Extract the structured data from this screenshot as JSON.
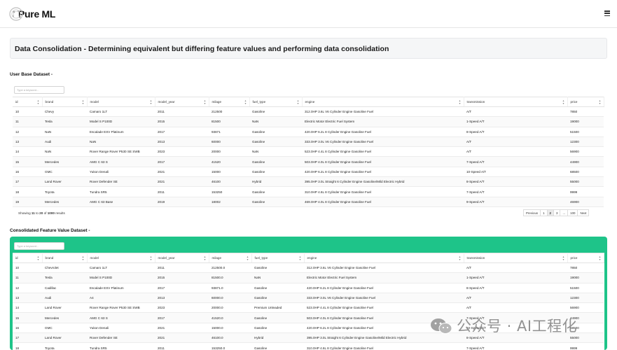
{
  "app": {
    "logo_text": "Pure ML"
  },
  "page_title": "Data Consolidation - Determining equivalent but differing feature values and performing data consolidation",
  "user_base": {
    "section_label": "User Base Dataset -",
    "search_placeholder": "Type a keyword...",
    "columns": [
      "id",
      "brand",
      "model",
      "model_year",
      "milage",
      "fuel_type",
      "engine",
      "transmission",
      "price"
    ],
    "rows": [
      [
        "10",
        "Chevy",
        "Camaro 1LT",
        "2011",
        "212500",
        "Gasoline",
        "312.0HP 3.6L V6 Cylinder Engine Gasoline Fuel",
        "A/T",
        "7850"
      ],
      [
        "11",
        "Tesla",
        "Model S P100D",
        "2015",
        "81500",
        "NaN",
        "Electric Motor Electric Fuel System",
        "1-Speed A/T",
        "19000"
      ],
      [
        "12",
        "NaN",
        "Escalade ESV Platinum",
        "2017",
        "93871",
        "Gasoline",
        "420.0HP 6.2L 8 Cylinder Engine Gasoline Fuel",
        "8-Speed A/T",
        "51500"
      ],
      [
        "13",
        "Audi",
        "NaN",
        "2013",
        "60000",
        "Gasoline",
        "333.0HP 3.0L V6 Cylinder Engine Gasoline Fuel",
        "A/T",
        "12300"
      ],
      [
        "14",
        "NaN",
        "Rover Range Rover P530 SE SWB",
        "2023",
        "20000",
        "NaN",
        "523.0HP 4.4L 8 Cylinder Engine Gasoline Fuel",
        "A/T",
        "56900"
      ],
      [
        "15",
        "Mercedes",
        "AMG C 63 S",
        "2017",
        "41520",
        "Gasoline",
        "503.0HP 4.0L 8 Cylinder Engine Gasoline Fuel",
        "7-Speed A/T",
        "44900"
      ],
      [
        "16",
        "GMC",
        "Yukon Denali",
        "2021",
        "15000",
        "Gasoline",
        "420.0HP 6.2L 8 Cylinder Engine Gasoline Fuel",
        "10-Speed A/T",
        "68500"
      ],
      [
        "17",
        "Land Rover",
        "Rover Defender SE",
        "2021",
        "46100",
        "Hybrid",
        "395.0HP 3.0L Straight 6 Cylinder Engine Gasoline/Mild Electric Hybrid",
        "8-Speed A/T",
        "55000"
      ],
      [
        "18",
        "Toyota",
        "Tundra SR5",
        "2011",
        "153250",
        "Gasoline",
        "310.0HP 4.6L 8 Cylinder Engine Gasoline Fuel",
        "7-Speed A/T",
        "9999"
      ],
      [
        "19",
        "Mercedes",
        "AMG C 63 Base",
        "2019",
        "18002",
        "Gasoline",
        "469.0HP 4.0L 8 Cylinder Engine Gasoline Fuel",
        "9-Speed A/T",
        "46900"
      ]
    ],
    "footer": {
      "prefix": "Showing",
      "from": "11",
      "to_word": "to",
      "to": "20",
      "of_word": "of",
      "total": "1000",
      "suffix": "results"
    },
    "pagination": [
      "Previous",
      "1",
      "2",
      "3",
      "...",
      "100",
      "Next"
    ]
  },
  "consolidated": {
    "section_label": "Consolidated Feature Value Dataset -",
    "search_placeholder": "Type a keyword...",
    "columns": [
      "id",
      "brand",
      "model",
      "model_year",
      "milage",
      "fuel_type",
      "engine",
      "transmission",
      "price"
    ],
    "rows": [
      [
        "10",
        "Chevrolet",
        "Camaro 1LT",
        "2011",
        "212500.0",
        "Gasoline",
        "312.0HP 3.6L V6 Cylinder Engine Gasoline Fuel",
        "A/T",
        "7850"
      ],
      [
        "11",
        "Tesla",
        "Model S P100D",
        "2015",
        "81500.0",
        "NaN",
        "Electric Motor Electric Fuel System",
        "1-Speed A/T",
        "19000"
      ],
      [
        "12",
        "Cadillac",
        "Escalade ESV Platinum",
        "2017",
        "93871.0",
        "Gasoline",
        "420.0HP 6.2L 8 Cylinder Engine Gasoline Fuel",
        "8-Speed A/T",
        "51500"
      ],
      [
        "13",
        "Audi",
        "A4",
        "2013",
        "60000.0",
        "Gasoline",
        "333.0HP 3.0L V6 Cylinder Engine Gasoline Fuel",
        "A/T",
        "12300"
      ],
      [
        "14",
        "Land Rover",
        "Rover Range Rover P530 SE SWB",
        "2023",
        "20000.0",
        "Premium Unleaded",
        "523.0HP 4.4L 8 Cylinder Engine Gasoline Fuel",
        "A/T",
        "56900"
      ],
      [
        "15",
        "Mercedes",
        "AMG C 63 S",
        "2017",
        "41520.0",
        "Gasoline",
        "503.0HP 4.0L 8 Cylinder Engine Gasoline Fuel",
        "7-Speed A/T",
        "44900"
      ],
      [
        "16",
        "GMC",
        "Yukon Denali",
        "2021",
        "15000.0",
        "Gasoline",
        "420.0HP 6.2L 8 Cylinder Engine Gasoline Fuel",
        "10-Speed A/T",
        "68500"
      ],
      [
        "17",
        "Land Rover",
        "Rover Defender SE",
        "2021",
        "46100.0",
        "Hybrid",
        "395.0HP 3.0L Straight 6 Cylinder Engine Gasoline/Mild Electric Hybrid",
        "8-Speed A/T",
        "55000"
      ],
      [
        "18",
        "Toyota",
        "Tundra SR5",
        "2011",
        "153250.0",
        "Gasoline",
        "310.0HP 4.6L 8 Cylinder Engine Gasoline Fuel",
        "7-Speed A/T",
        "9999"
      ]
    ]
  },
  "watermark": {
    "text": "公众号 · AI工程化"
  },
  "colors": {
    "accent_green": "#1ec489",
    "title_card_bg": "#f5f6f7",
    "page_bg": "#ffffff"
  },
  "icons": {
    "logo": "pure-ml-logo-icon",
    "menu": "hamburger-menu-icon",
    "sort": "sort-arrows-icon",
    "watermark": "wechat-icon"
  }
}
